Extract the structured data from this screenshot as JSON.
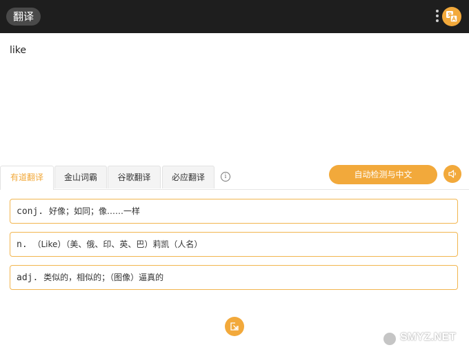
{
  "header": {
    "title": "翻译"
  },
  "source": {
    "text": "like"
  },
  "tabs": [
    {
      "label": "有道翻译",
      "active": true
    },
    {
      "label": "金山词霸",
      "active": false
    },
    {
      "label": "谷歌翻译",
      "active": false
    },
    {
      "label": "必应翻译",
      "active": false
    }
  ],
  "language_button": {
    "label": "自动检测与中文"
  },
  "results": [
    {
      "pos": "conj.",
      "definition": "好像；如同；像……一样"
    },
    {
      "pos": "n.",
      "definition": "（Like）（美、俄、印、英、巴）莉凯（人名）"
    },
    {
      "pos": "adj.",
      "definition": "类似的，相似的；（图像）逼真的"
    }
  ],
  "watermark": {
    "text": "SMYZ.NET"
  },
  "icons": {
    "more": "more-vertical-icon",
    "app": "translate-icon",
    "info": "info-icon",
    "speaker": "speaker-icon",
    "open": "open-external-icon"
  },
  "colors": {
    "accent": "#f2a93b",
    "header_bg": "#1e1e1e",
    "card_border": "#f2b54e"
  }
}
